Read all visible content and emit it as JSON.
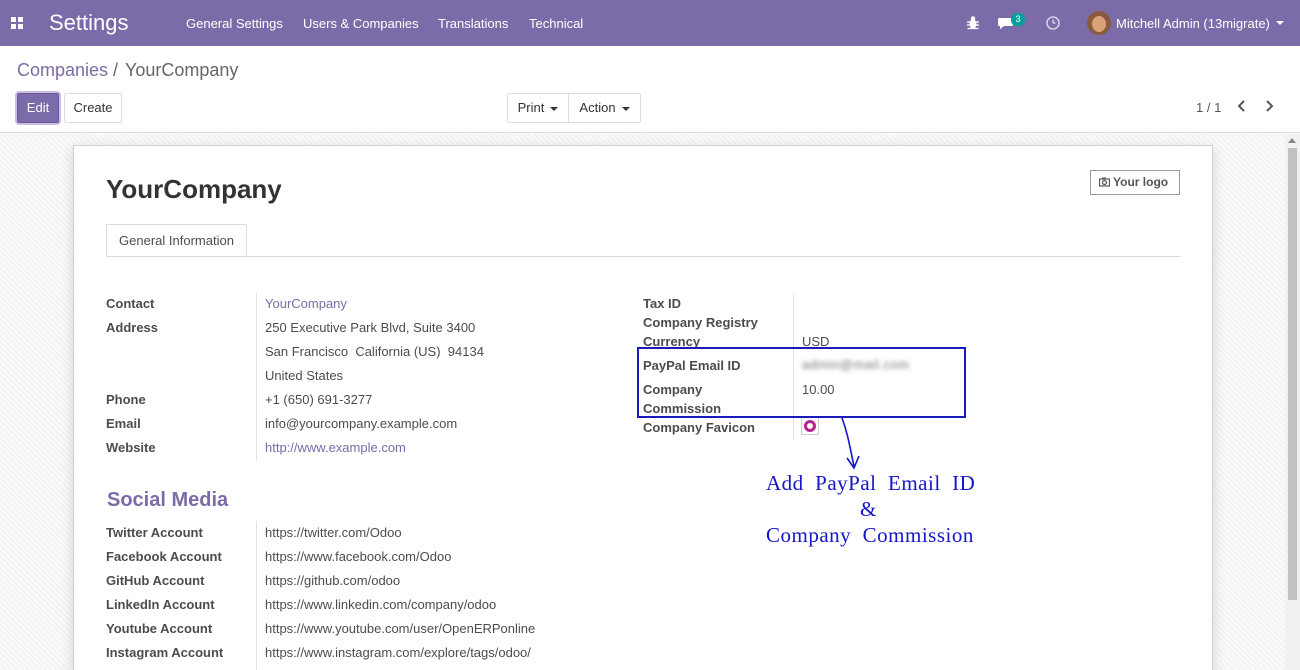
{
  "navbar": {
    "brand": "Settings",
    "menu": [
      "General Settings",
      "Users & Companies",
      "Translations",
      "Technical"
    ],
    "message_count": "3",
    "user_name": "Mitchell Admin (13migrate)"
  },
  "breadcrumb": {
    "parent": "Companies",
    "separator": "/",
    "current": "YourCompany"
  },
  "buttons": {
    "edit": "Edit",
    "create": "Create",
    "print": "Print",
    "action": "Action"
  },
  "pager": {
    "value": "1 / 1"
  },
  "form": {
    "company_name": "YourCompany",
    "logo_button": "Your logo",
    "tab": "General Information",
    "left_fields": {
      "contact_label": "Contact",
      "contact_value": "YourCompany",
      "address_label": "Address",
      "address_line1": "250 Executive Park Blvd, Suite 3400",
      "address_line2": "San Francisco  California (US)  94134",
      "address_line3": "United States",
      "phone_label": "Phone",
      "phone_value": "+1 (650) 691-3277",
      "email_label": "Email",
      "email_value": "info@yourcompany.example.com",
      "website_label": "Website",
      "website_value": "http://www.example.com"
    },
    "right_fields": {
      "tax_id_label": "Tax ID",
      "registry_label": "Company Registry",
      "currency_label": "Currency",
      "currency_value": "USD",
      "paypal_label": "PayPal Email ID",
      "paypal_value": "admin@mail.com",
      "commission_label_1": "Company",
      "commission_label_2": "Commission",
      "commission_value": "10.00",
      "favicon_label": "Company Favicon"
    },
    "social": {
      "title": "Social Media",
      "rows": [
        {
          "label": "Twitter Account",
          "value": "https://twitter.com/Odoo"
        },
        {
          "label": "Facebook Account",
          "value": "https://www.facebook.com/Odoo"
        },
        {
          "label": "GitHub Account",
          "value": "https://github.com/odoo"
        },
        {
          "label": "LinkedIn Account",
          "value": "https://www.linkedin.com/company/odoo"
        },
        {
          "label": "Youtube Account",
          "value": "https://www.youtube.com/user/OpenERPonline"
        },
        {
          "label": "Instagram Account",
          "value": "https://www.instagram.com/explore/tags/odoo/"
        }
      ]
    }
  },
  "annotation": {
    "line1": "Add  PayPal  Email  ID",
    "line2": "&",
    "line3": "Company  Commission",
    "color": "#1515c9"
  },
  "colors": {
    "brand": "#7c6ba9",
    "highlight_box": "#1a1ab8",
    "favicon": "#b8248f"
  }
}
